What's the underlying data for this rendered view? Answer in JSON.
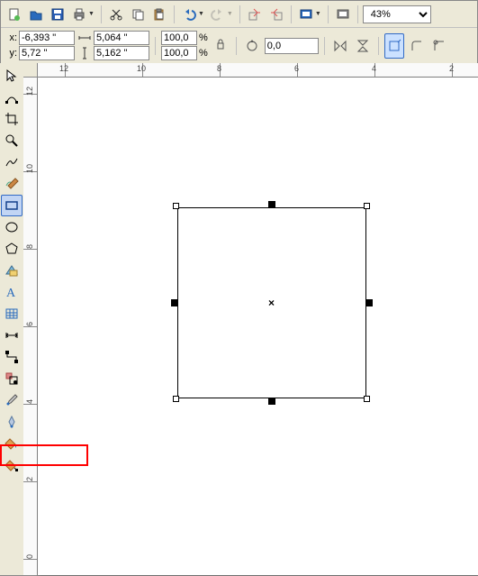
{
  "top_toolbar": {
    "zoom_value": "43%"
  },
  "properties": {
    "x": "-6,393 \"",
    "y": "5,72 \"",
    "w": "5,064 \"",
    "h": "5,162 \"",
    "sx": "100,0",
    "sy": "100,0",
    "rotation": "0,0"
  },
  "ruler_h_labels": [
    "12",
    "10",
    "8",
    "6",
    "4",
    "2"
  ],
  "ruler_v_labels": [
    "12",
    "10",
    "8",
    "6",
    "4",
    "2",
    "0"
  ],
  "tool_names": [
    "pick",
    "shape-edit",
    "crop",
    "zoom",
    "freehand",
    "smart-drawing",
    "rectangle",
    "ellipse",
    "polygon",
    "basic-shapes",
    "text",
    "table",
    "dimension",
    "connector",
    "interactive",
    "eyedropper",
    "outline-pen",
    "fill",
    "interactive-fill"
  ]
}
